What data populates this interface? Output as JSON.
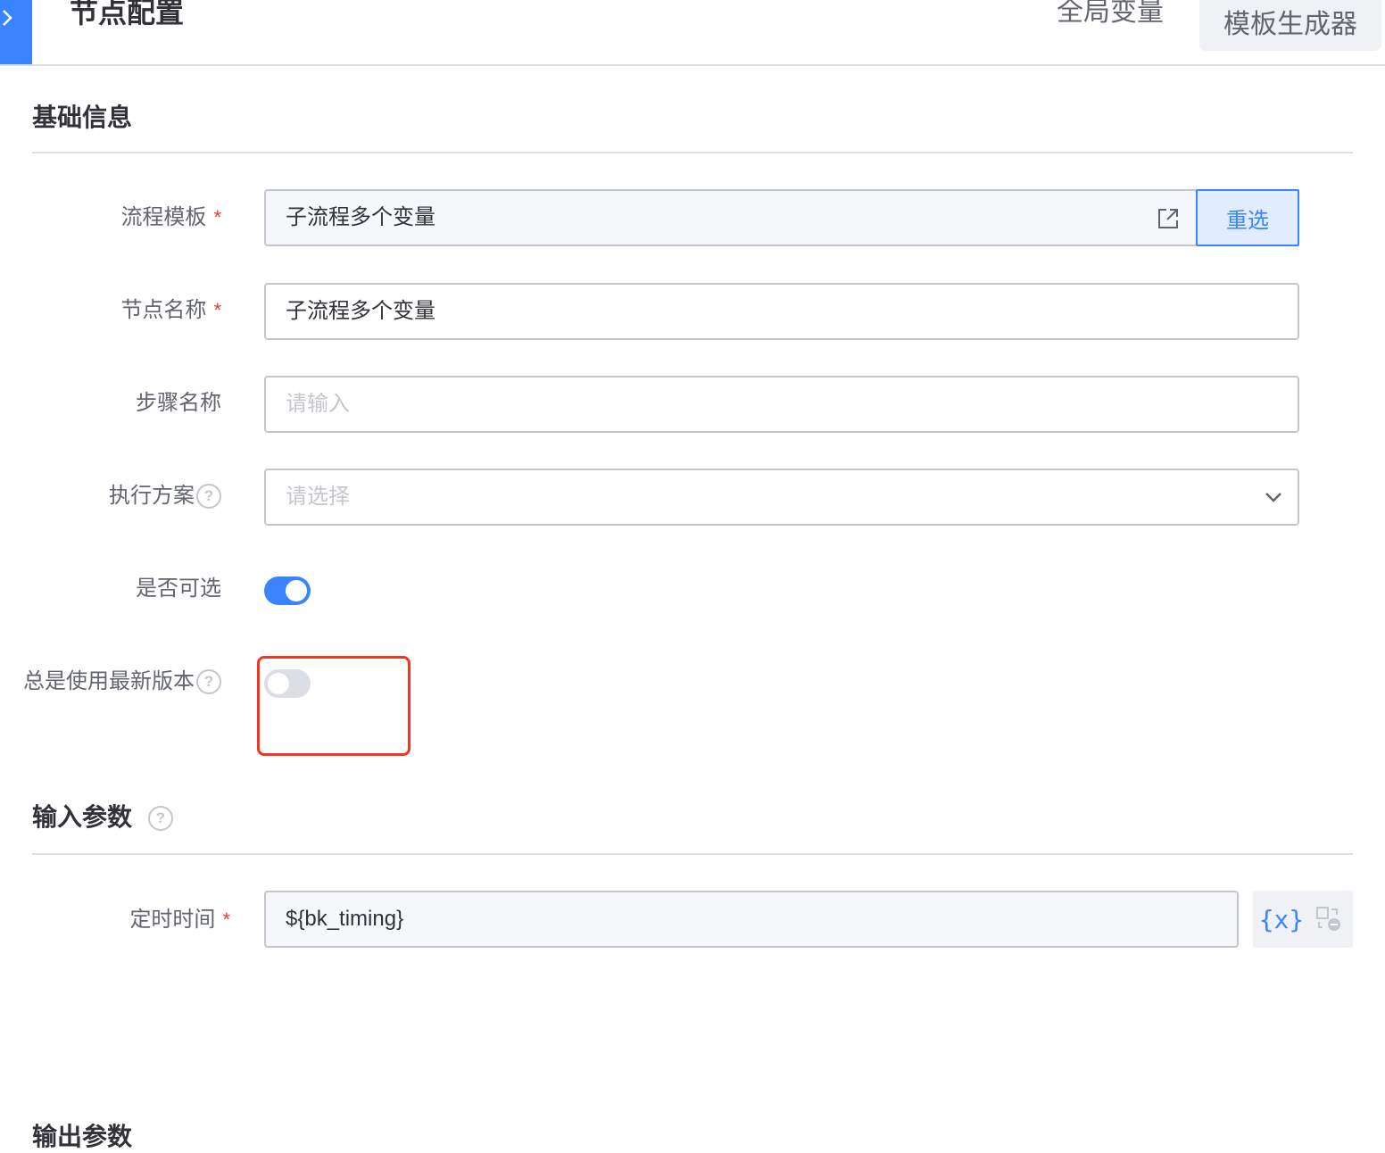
{
  "header": {
    "title": "节点配置",
    "global_variables": "全局变量",
    "template_generator": "模板生成器"
  },
  "basic_info": {
    "title": "基础信息",
    "fields": {
      "process_template": {
        "label": "流程模板",
        "value": "子流程多个变量",
        "action": "重选"
      },
      "node_name": {
        "label": "节点名称",
        "value": "子流程多个变量"
      },
      "step_name": {
        "label": "步骤名称",
        "placeholder": "请输入"
      },
      "execution_plan": {
        "label": "执行方案",
        "placeholder": "请选择"
      },
      "optional": {
        "label": "是否可选",
        "on": true
      },
      "always_latest": {
        "label": "总是使用最新版本",
        "on": false
      }
    }
  },
  "input_params": {
    "title": "输入参数",
    "fields": {
      "timing": {
        "label": "定时时间",
        "value": "${bk_timing}",
        "var_label": "{x}"
      }
    }
  },
  "output_params": {
    "title": "输出参数"
  },
  "colors": {
    "primary": "#3a84ff",
    "required": "#ea3636",
    "highlight": "#f5341f"
  }
}
